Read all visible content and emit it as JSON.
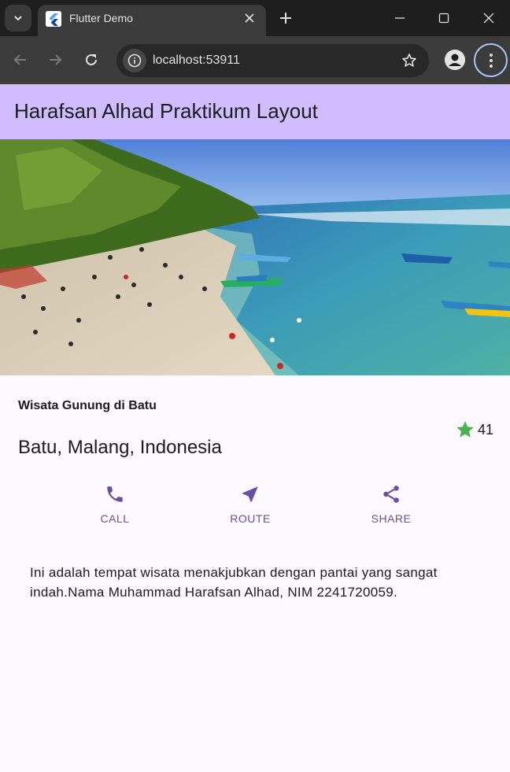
{
  "browser": {
    "tab_title": "Flutter Demo",
    "url": "localhost:53911"
  },
  "app": {
    "title": "Harafsan Alhad Praktikum Layout",
    "place_title": "Wisata Gunung di Batu",
    "location": "Batu, Malang, Indonesia",
    "rating_count": "41",
    "actions": [
      {
        "label": "CALL",
        "icon": "phone-icon"
      },
      {
        "label": "ROUTE",
        "icon": "navigation-icon"
      },
      {
        "label": "SHARE",
        "icon": "share-icon"
      }
    ],
    "description": "Ini adalah tempat wisata menakjubkan dengan pantai yang sangat indah.Nama Muhammad Harafsan Alhad, NIM 2241720059.",
    "colors": {
      "appbar": "#d0bcff",
      "accent": "#6750a4",
      "star": "#4caf50"
    }
  }
}
